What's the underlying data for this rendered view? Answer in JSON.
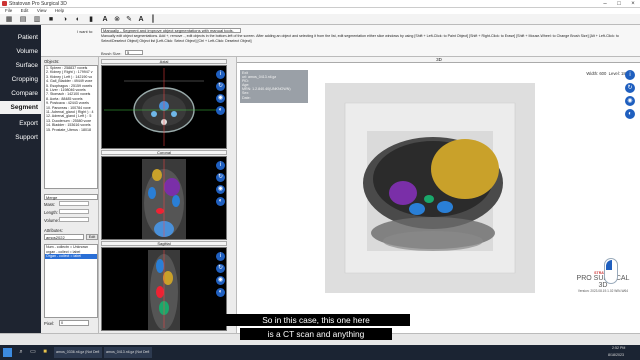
{
  "window": {
    "title": "Stratovan Pro Surgical 3D"
  },
  "menu": [
    "File",
    "Edit",
    "View",
    "Help"
  ],
  "nav": [
    "Patient",
    "Volume",
    "Surface",
    "Cropping",
    "Compare",
    "Segment",
    "Export",
    "Support"
  ],
  "nav_active": "Segment",
  "wizard": {
    "label": "I want to:",
    "mode": "Manually  -  Segment and improve object segmentations with manual tools.",
    "line1": "Manually edit object segmentations. Add +, remove -, edit objects in the bottom-left of the screen. After adding an object and selecting it from the list, edit segmentation either slice windows by using [Shift + Left-Click: to Paint Object] [Shift + Right-Click: to Erase] [Shift + Mouse-Wheel: to Change Brush Size] [Alt + Left-Click: to Select/Deselect Object] Object list [Left-Click: Select Object] [Ctrl + Left-Click: Deselect Object]",
    "brush_label": "Brush Size:",
    "brush_value": "5"
  },
  "left": {
    "objects_label": "Objects:",
    "objects": [
      "1. Spleen : 258837 voxels",
      "2. Kidney ( Right ) : 179947 v",
      "3. Kidney ( Left ) : 142190 vo",
      "4. Gall_Bladder : 49449 voxe",
      "5. Esophagus : 25159 voxels",
      "6. Liver : 1198046 voxels",
      "7. Stomach : 142100 voxels",
      "8. Aorta : 88485 voxels",
      "9. Postcava : 42443 voxels",
      "10. Pancreas : 100784 voxe",
      "11. Adrenal_gland ( Right ) : 4",
      "12. Adrenal_gland ( Left ) : 5",
      "13. Duodenum : 25580 voxe",
      "14. Bladder : 153616 voxels",
      "15. Prostate_Uterus : 18018"
    ],
    "op_select": "Merge",
    "mass_label": "Mass:",
    "length_label": "Length:",
    "volume_label": "Volume:",
    "attributes_label": "Attributes:",
    "attr_select": "amos2022",
    "attr_button": "Edit",
    "attrs": [
      "Num - collectn = Unknown",
      "organ - collect = label"
    ],
    "attr_selected": "Organ - collect = label",
    "pixel_label": "Pixel:",
    "pixel_value": "0"
  },
  "slices": {
    "axial": "Axial",
    "coronal": "Coronal",
    "sagittal": "Sagittal"
  },
  "view3d": {
    "title": "3D",
    "info": [
      "Exit",
      "  url: amos_0413.nii.gz",
      "  PID:",
      "  Age:",
      "  MRN: 1.2.840.40(UNKNOWN)",
      "  Sex:",
      "  Date:"
    ],
    "window": "Width: 600",
    "level": "Level: 180",
    "logo_top": "STRATOVAN",
    "logo_main": "PRO SURGICAL 3D",
    "logo_sub": "Version: 2023.08.19.1.02 WIN-W64"
  },
  "caption": {
    "line1": "So in this case, this one here",
    "line2": "is a CT scan and anything"
  },
  "taskbar": {
    "item1": "amos_0336.nii.gz (Not Defi",
    "item2": "amos_0413.nii.gz (Not Defi",
    "time": "2:52 PM",
    "date": "8/18/2023"
  },
  "colors": {
    "accent": "#1f5fbf",
    "nav_bg": "#1e2430",
    "liver": "#c9a12a",
    "spleen": "#7a2fa8",
    "kidney": "#2a7fd6"
  }
}
